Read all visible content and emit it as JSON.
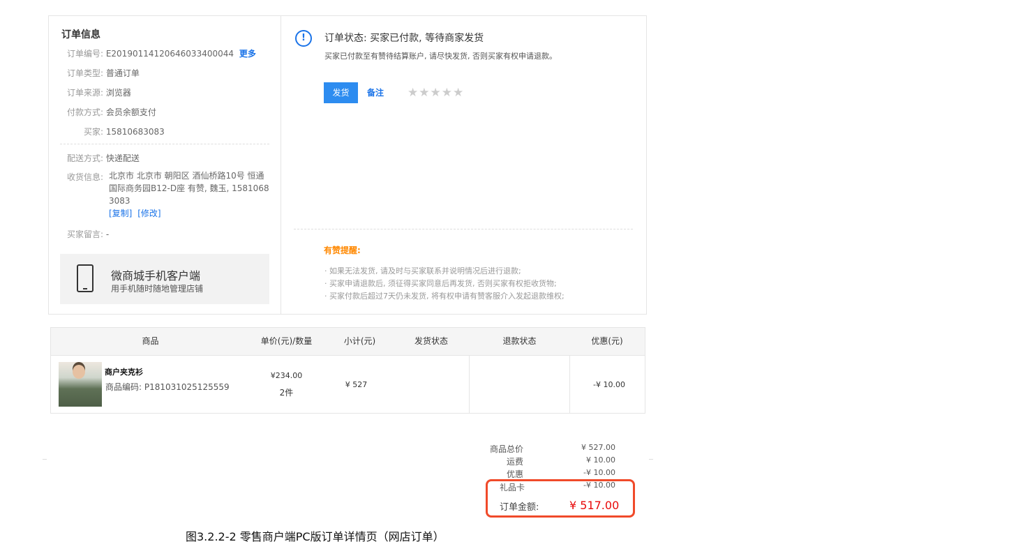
{
  "order_info": {
    "title": "订单信息",
    "fields": [
      {
        "label": "订单编号:",
        "value": "E20190114120646033400044",
        "link": "更多"
      },
      {
        "label": "订单类型:",
        "value": "普通订单"
      },
      {
        "label": "订单来源:",
        "value": "浏览器"
      },
      {
        "label": "付款方式:",
        "value": "会员余额支付"
      },
      {
        "label": "买家:",
        "value": "15810683083"
      }
    ],
    "delivery_label": "配送方式:",
    "delivery_value": "快递配送",
    "address_label": "收货信息:",
    "address_lines": [
      "北京市 北京市 朝阳区 酒仙桥路10号 恒通",
      "国际商务园B12-D座 有赞, 魏玉, 1581068",
      "3083"
    ],
    "copy_link": "[复制]",
    "edit_link": "[修改]",
    "message_label": "买家留言:",
    "message_value": "-"
  },
  "mobile_card": {
    "title": "微商城手机客户端",
    "subtitle": "用手机随时随地管理店铺",
    "icon": "phone-icon"
  },
  "status": {
    "icon": "exclamation-circle-icon",
    "title": "订单状态: 买家已付款, 等待商家发货",
    "desc": "买家已付款至有赞待结算账户, 请尽快发货, 否则买家有权申请退款。",
    "ship_button": "发货",
    "note_link": "备注",
    "rating_stars": 0,
    "rating_max": 5
  },
  "tips": {
    "title": "有赞提醒:",
    "items": [
      "· 如果无法发货, 请及时与买家联系并说明情况后进行退款;",
      "· 买家申请退款后, 须征得买家同意后再发货, 否则买家有权拒收货物;",
      "· 买家付款后超过7天仍未发货, 将有权申请有赞客服介入发起退款维权;"
    ]
  },
  "table": {
    "headers": [
      "商品",
      "单价(元)/数量",
      "小计(元)",
      "发货状态",
      "退款状态",
      "优惠(元)"
    ],
    "row": {
      "name": "商户夹克衫",
      "code": "商品编码: P181031025125559",
      "price": "¥234.00",
      "qty": "2件",
      "subtotal": "¥ 527",
      "ship_status": "",
      "refund_status": "",
      "discount": "-¥ 10.00"
    }
  },
  "summary": {
    "items": [
      {
        "label": "商品总价",
        "value": "¥ 527.00"
      },
      {
        "label": "运费",
        "value": "¥ 10.00"
      },
      {
        "label": "优惠",
        "value": "-¥ 10.00"
      },
      {
        "label": "礼品卡",
        "value": "-¥ 10.00"
      }
    ],
    "total_label": "订单金额:",
    "total_value": "¥ 517.00"
  },
  "caption": "图3.2.2-2 零售商户端PC版订单详情页（网店订单）",
  "colors": {
    "accent": "#2d8cf0",
    "link": "#1a73e8",
    "warn": "#ff8800",
    "total": "#e80a0a",
    "highlight_border": "#f04a2a"
  }
}
